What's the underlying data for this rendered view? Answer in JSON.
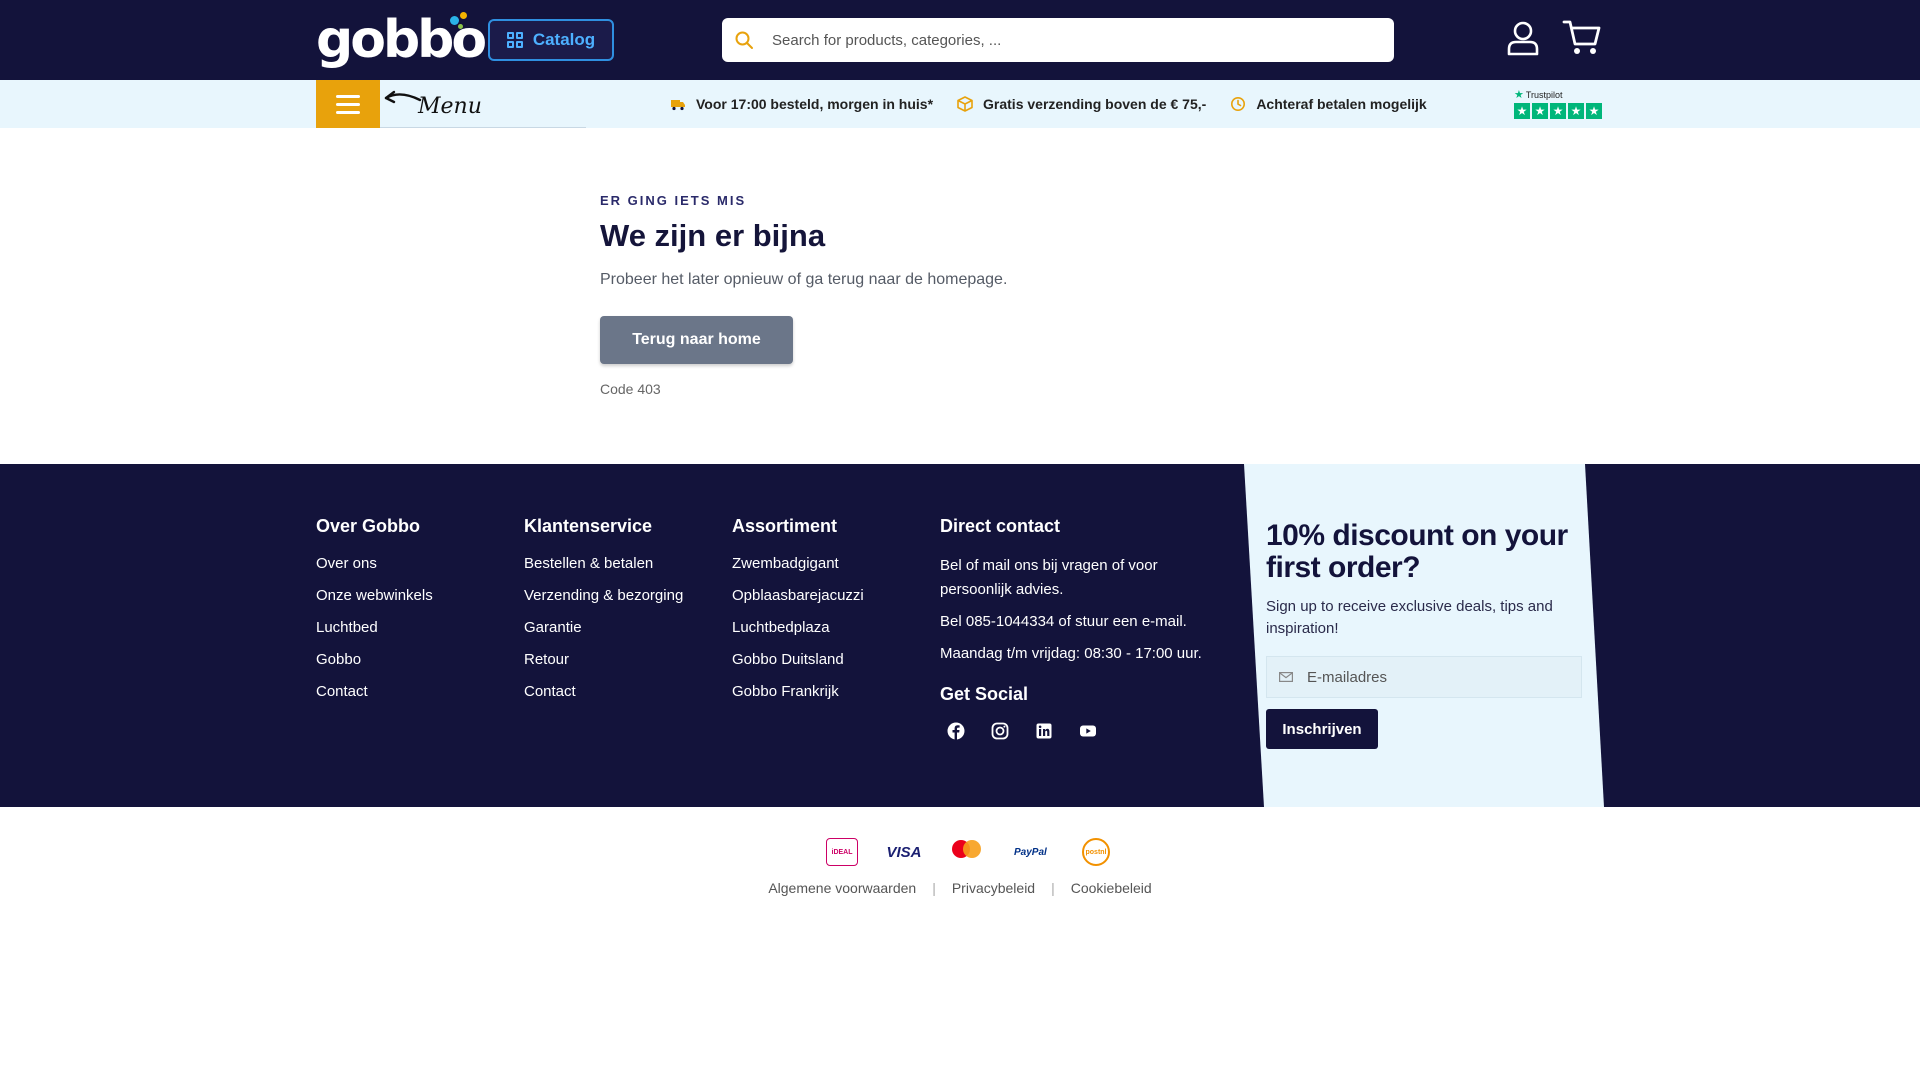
{
  "header": {
    "logo_text": "gobbo",
    "catalog_label": "Catalog",
    "search_placeholder": "Search for products, categories, ...",
    "colors": {
      "background": "#13133b",
      "accent": "#2f8fe0"
    }
  },
  "usp_bar": {
    "menu_annotation": "Menu",
    "items": [
      {
        "icon": "truck-icon",
        "label": "Voor 17:00 besteld, morgen in huis*"
      },
      {
        "icon": "package-icon",
        "label": "Gratis verzending boven de € 75,-"
      },
      {
        "icon": "clock-icon",
        "label": "Achteraf betalen mogelijk"
      }
    ],
    "trustpilot_label": "Trustpilot",
    "trustpilot_stars": 5
  },
  "error": {
    "eyebrow": "ER GING IETS MIS",
    "title": "We zijn er bijna",
    "text": "Probeer het later opnieuw of ga terug naar de homepage.",
    "button": "Terug naar home",
    "code": "Code 403"
  },
  "footer": {
    "columns": [
      {
        "title": "Over Gobbo",
        "links": [
          "Over ons",
          "Onze webwinkels",
          "Luchtbed",
          "Gobbo",
          "Contact"
        ]
      },
      {
        "title": "Klantenservice",
        "links": [
          "Bestellen & betalen",
          "Verzending & bezorging",
          "Garantie",
          "Retour",
          "Contact"
        ]
      },
      {
        "title": "Assortiment",
        "links": [
          "Zwembadgigant",
          "Opblaasbarejacuzzi",
          "Luchtbedplaza",
          "Gobbo Duitsland",
          "Gobbo Frankrijk"
        ]
      }
    ],
    "contact": {
      "title": "Direct contact",
      "lines": [
        "Bel of mail ons bij vragen of voor persoonlijk advies.",
        "Bel 085-1044334 of stuur een e-mail.",
        "Maandag t/m vrijdag: 08:30 - 17:00 uur."
      ],
      "social_title": "Get Social",
      "socials": [
        "facebook-icon",
        "instagram-icon",
        "linkedin-icon",
        "youtube-icon"
      ]
    },
    "signup": {
      "title": "10% discount on your first order?",
      "text": "Sign up to receive exclusive deals, tips and inspiration!",
      "email_placeholder": "E-mailadres",
      "button": "Inschrijven"
    }
  },
  "payments": {
    "ideal": "iDEAL",
    "visa": "VISA",
    "paypal": "PayPal",
    "postnl": "postnl"
  },
  "legal": {
    "links": [
      "Algemene voorwaarden",
      "Privacybeleid",
      "Cookiebeleid"
    ],
    "separator": "|"
  }
}
